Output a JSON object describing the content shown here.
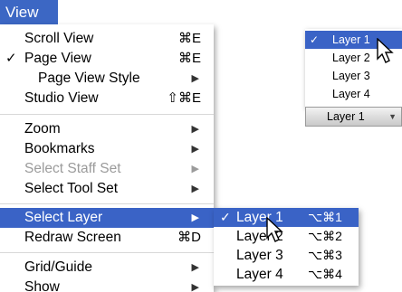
{
  "menu_title": "View",
  "menu": {
    "items": [
      {
        "label": "Scroll View",
        "check": "",
        "shortcut": "⌘E",
        "arrow": ""
      },
      {
        "label": "Page View",
        "check": "✓",
        "shortcut": "⌘E",
        "arrow": ""
      },
      {
        "label": "Page View Style",
        "check": "",
        "shortcut": "",
        "arrow": "▶"
      },
      {
        "label": "Studio View",
        "check": "",
        "shortcut": "⇧⌘E",
        "arrow": ""
      },
      {
        "label": "Zoom",
        "check": "",
        "shortcut": "",
        "arrow": "▶"
      },
      {
        "label": "Bookmarks",
        "check": "",
        "shortcut": "",
        "arrow": "▶"
      },
      {
        "label": "Select Staff Set",
        "check": "",
        "shortcut": "",
        "arrow": "▶"
      },
      {
        "label": "Select Tool Set",
        "check": "",
        "shortcut": "",
        "arrow": "▶"
      },
      {
        "label": "Select Layer",
        "check": "",
        "shortcut": "",
        "arrow": "▶"
      },
      {
        "label": "Redraw Screen",
        "check": "",
        "shortcut": "⌘D",
        "arrow": ""
      },
      {
        "label": "Grid/Guide",
        "check": "",
        "shortcut": "",
        "arrow": "▶"
      },
      {
        "label": "Show",
        "check": "",
        "shortcut": "",
        "arrow": "▶"
      }
    ]
  },
  "submenu": {
    "items": [
      {
        "label": "Layer 1",
        "check": "✓",
        "shortcut": "⌥⌘1"
      },
      {
        "label": "Layer 2",
        "check": "",
        "shortcut": "⌥⌘2"
      },
      {
        "label": "Layer 3",
        "check": "",
        "shortcut": "⌥⌘3"
      },
      {
        "label": "Layer 4",
        "check": "",
        "shortcut": "⌥⌘4"
      }
    ]
  },
  "layer_popup": {
    "items": [
      {
        "label": "Layer 1",
        "check": "✓"
      },
      {
        "label": "Layer 2",
        "check": ""
      },
      {
        "label": "Layer 3",
        "check": ""
      },
      {
        "label": "Layer 4",
        "check": ""
      }
    ],
    "current": "Layer 1",
    "arrow": "▼"
  },
  "colors": {
    "highlight": "#3a63c6",
    "menubar": "#3c67c4",
    "disabled": "#9b9b9b"
  }
}
